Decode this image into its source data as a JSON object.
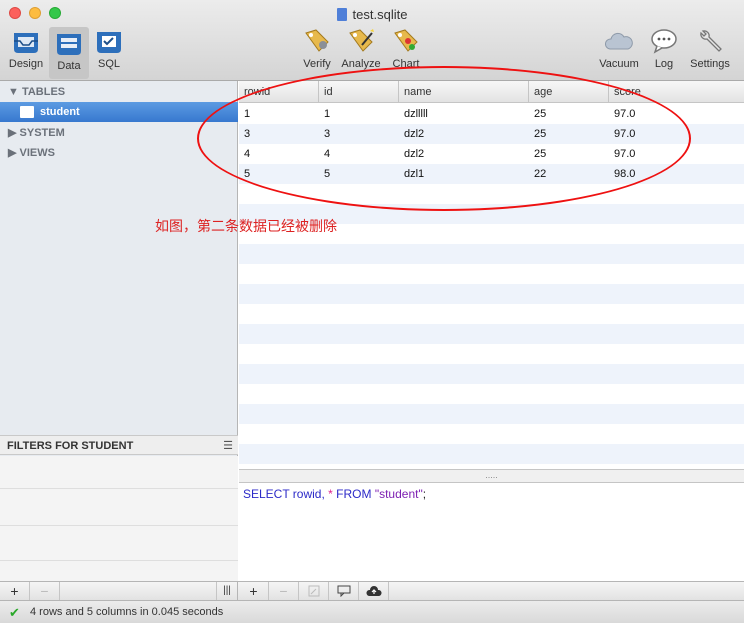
{
  "window": {
    "title": "test.sqlite"
  },
  "toolbar": {
    "left": [
      {
        "label": "Design",
        "icon": "design-icon"
      },
      {
        "label": "Data",
        "icon": "data-icon",
        "active": true
      },
      {
        "label": "SQL",
        "icon": "sql-icon"
      }
    ],
    "center": [
      {
        "label": "Verify",
        "icon": "verify-icon"
      },
      {
        "label": "Analyze",
        "icon": "analyze-icon"
      },
      {
        "label": "Chart",
        "icon": "chart-icon"
      }
    ],
    "right": [
      {
        "label": "Vacuum",
        "icon": "cloud-icon"
      },
      {
        "label": "Log",
        "icon": "speech-bubble-icon"
      },
      {
        "label": "Settings",
        "icon": "wrench-icon"
      }
    ]
  },
  "sidebar": {
    "tables_label": "TABLES",
    "selected_table": "student",
    "system_label": "SYSTEM",
    "views_label": "VIEWS",
    "filters_label": "FILTERS FOR STUDENT"
  },
  "grid": {
    "columns": [
      "rowid",
      "id",
      "name",
      "age",
      "score"
    ],
    "rows": [
      [
        "1",
        "1",
        "dzlllll",
        "25",
        "97.0"
      ],
      [
        "3",
        "3",
        "dzl2",
        "25",
        "97.0"
      ],
      [
        "4",
        "4",
        "dzl2",
        "25",
        "97.0"
      ],
      [
        "5",
        "5",
        "dzl1",
        "22",
        "98.0"
      ]
    ]
  },
  "annotation": {
    "text": "如图，第二条数据已经被删除"
  },
  "query": {
    "kw1": "SELECT rowid,",
    "star": " * ",
    "kw2": "FROM ",
    "table": "\"student\"",
    "end": ";"
  },
  "bottom": {
    "plus": "+",
    "minus": "−",
    "columns_icon": "|||"
  },
  "status": {
    "text": "4 rows and 5 columns in 0.045 seconds"
  },
  "colors": {
    "accent": "#3778cf",
    "annotation": "#dd1111"
  }
}
